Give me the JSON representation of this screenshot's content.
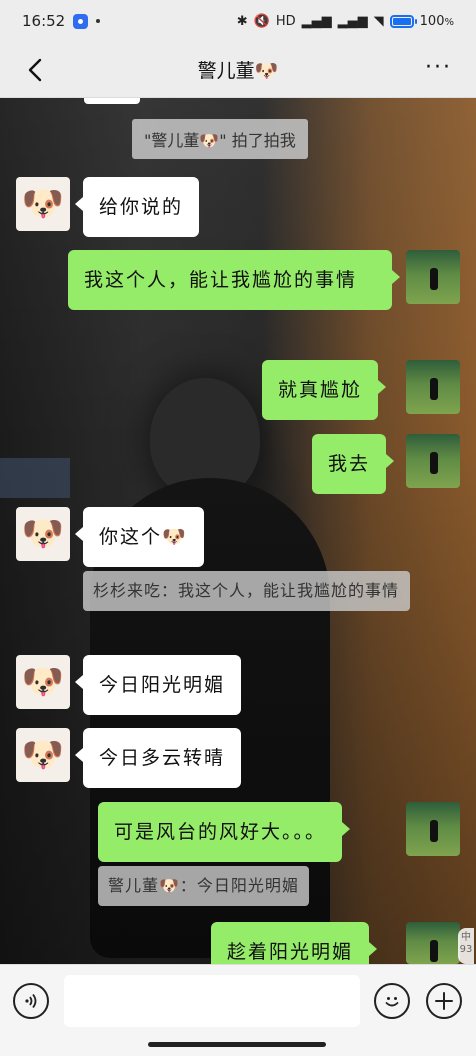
{
  "status": {
    "time": "16:52",
    "battery": "100",
    "battery_unit": "%",
    "net_label": "HD"
  },
  "header": {
    "title": "警儿董🐶"
  },
  "messages": {
    "system_pat": "\"警儿董🐶\" 拍了拍我",
    "m1": "给你说的",
    "m2": "我这个人，能让我尴尬的事情",
    "m3": "就真尴尬",
    "m4": "我去",
    "m5": "你这个🐶",
    "q1": "杉杉来吃：我这个人，能让我尴尬的事情",
    "m6": "今日阳光明媚",
    "m7": "今日多云转晴",
    "m8": "可是风台的风好大。。。",
    "q2": "警儿董🐶：今日阳光明媚",
    "m9": "趁着阳光明媚"
  },
  "side_note": {
    "text": "中 93"
  },
  "input": {
    "placeholder": ""
  },
  "icons": {
    "back": "chevron-left-icon",
    "more": "more-dots-icon",
    "voice": "voice-icon",
    "emoji": "emoji-icon",
    "plus": "plus-icon"
  },
  "colors": {
    "bubble_me": "#95ec69",
    "bubble_other": "#ffffff",
    "bar_bg": "#ededed"
  }
}
